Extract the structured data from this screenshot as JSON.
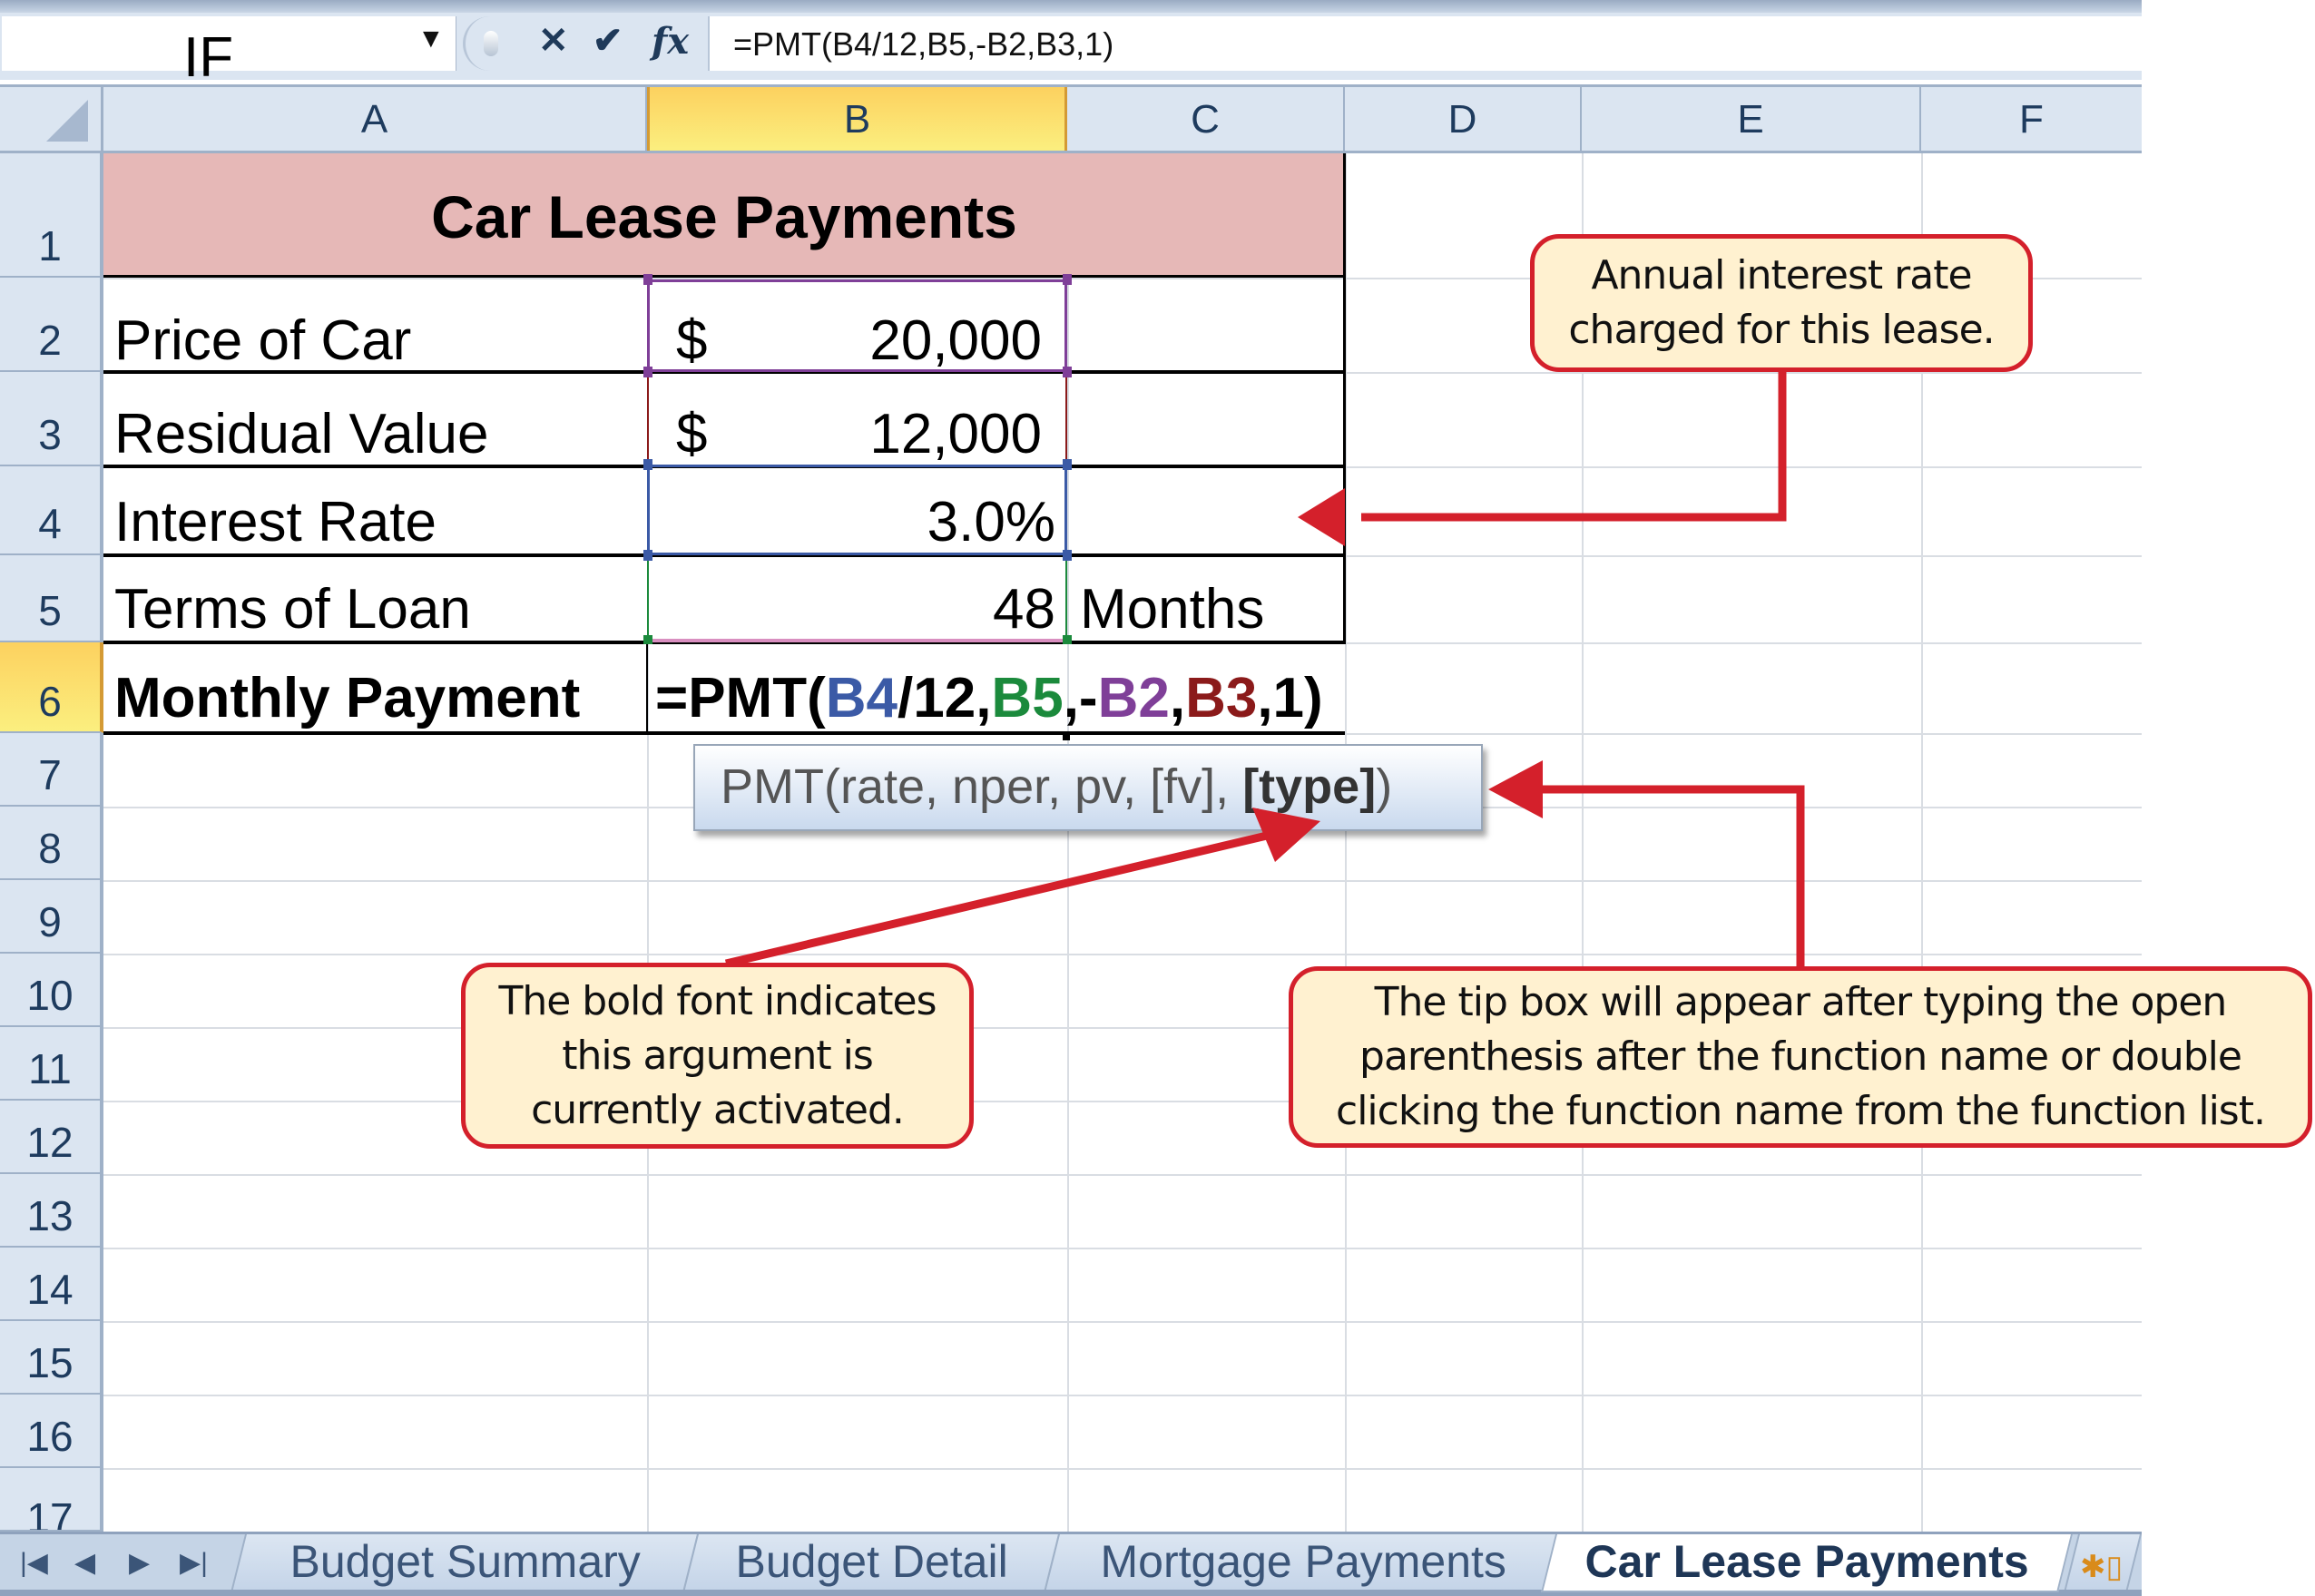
{
  "formula_bar": {
    "name_box": "IF",
    "name_box_dropdown_icon": "triangle-down",
    "buttons": {
      "cancel": "✕",
      "enter": "✔",
      "insert_function": "fx"
    },
    "formula": "=PMT(B4/12,B5,-B2,B3,1)"
  },
  "columns": [
    "A",
    "B",
    "C",
    "D",
    "E",
    "F"
  ],
  "selected_column": "B",
  "rows": [
    "1",
    "2",
    "3",
    "4",
    "5",
    "6",
    "7",
    "8",
    "9",
    "10",
    "11",
    "12",
    "13",
    "14",
    "15",
    "16",
    "17"
  ],
  "selected_row": "6",
  "sheet": {
    "title": "Car Lease Payments",
    "items": [
      {
        "label": "Price of Car",
        "currency": "$",
        "value": "20,000",
        "ref_color": "#7f3f98"
      },
      {
        "label": "Residual Value",
        "currency": "$",
        "value": "12,000",
        "ref_color": "#8b1a1a"
      },
      {
        "label": "Interest Rate",
        "currency": "",
        "value": "3.0%",
        "ref_color": "#3b5aa6"
      },
      {
        "label": "Terms of Loan",
        "currency": "",
        "value": "48",
        "unit": "Months",
        "ref_color": "#1b8a3c"
      }
    ],
    "payment_label": "Monthly Payment",
    "payment_formula_parts": [
      {
        "text": "=PMT(",
        "color": "#000000"
      },
      {
        "text": "B4",
        "color": "#3b5aa6"
      },
      {
        "text": "/12,",
        "color": "#000000"
      },
      {
        "text": "B5",
        "color": "#1b8a3c"
      },
      {
        "text": ",-",
        "color": "#000000"
      },
      {
        "text": "B2",
        "color": "#7f3f98"
      },
      {
        "text": ",",
        "color": "#000000"
      },
      {
        "text": "B3",
        "color": "#8b1a1a"
      },
      {
        "text": ",1)",
        "color": "#000000"
      }
    ]
  },
  "tooltip": {
    "prefix": "PMT(rate, nper, pv, [fv], ",
    "active_arg": "[type]",
    "suffix": ")"
  },
  "callouts": {
    "interest": [
      "Annual interest rate",
      "charged for this lease."
    ],
    "bold_font": [
      "The bold font indicates",
      "this argument is",
      "currently activated."
    ],
    "tip_box": [
      "The tip box will appear after typing the open",
      "parenthesis after the function name or double",
      "clicking the function name from the function list."
    ]
  },
  "accent_color": "#d4202b",
  "sheet_tabs": {
    "nav": [
      "first-sheet",
      "prev-sheet",
      "next-sheet",
      "last-sheet"
    ],
    "tabs": [
      "Budget Summary",
      "Budget Detail",
      "Mortgage Payments",
      "Car Lease Payments"
    ],
    "active": "Car Lease Payments",
    "insert_sheet_icon": "insert-worksheet"
  }
}
